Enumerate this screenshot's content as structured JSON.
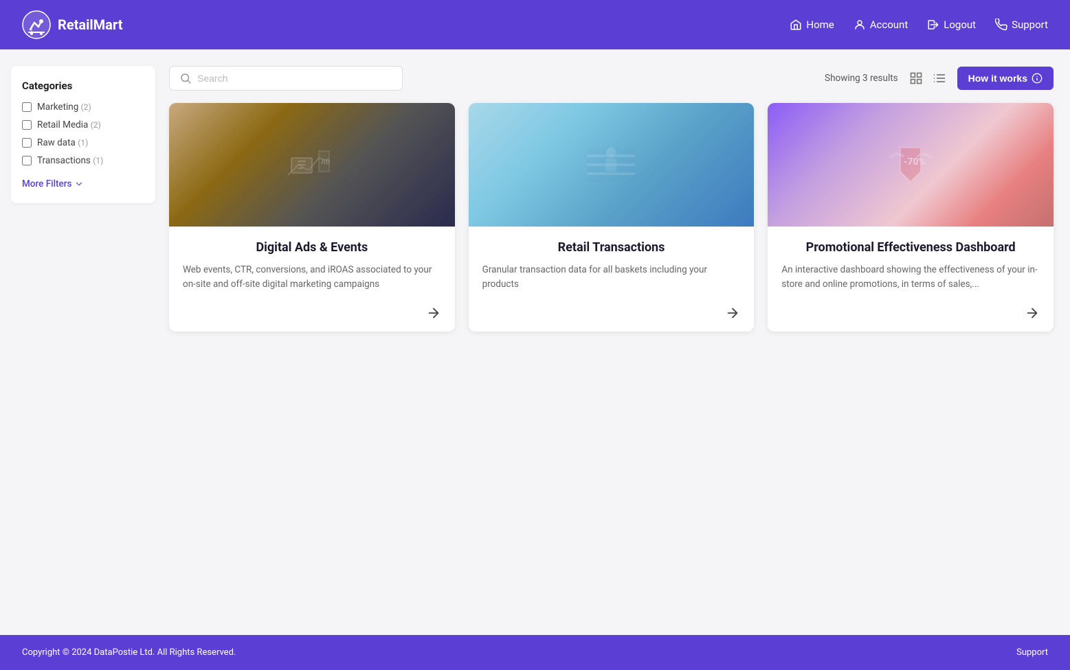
{
  "header": {
    "logo_text": "RetailMart",
    "nav": {
      "home": "Home",
      "account": "Account",
      "logout": "Logout",
      "support": "Support"
    }
  },
  "sidebar": {
    "title": "Categories",
    "filters": [
      {
        "label": "Marketing",
        "count": "(2)",
        "checked": false
      },
      {
        "label": "Retail Media",
        "count": "(2)",
        "checked": false
      },
      {
        "label": "Raw data",
        "count": "(1)",
        "checked": false
      },
      {
        "label": "Transactions",
        "count": "(1)",
        "checked": false
      }
    ],
    "more_filters": "More Filters"
  },
  "toolbar": {
    "search_placeholder": "Search",
    "results_count": "Showing 3 results",
    "how_it_works": "How it works"
  },
  "cards": [
    {
      "title": "Digital Ads & Events",
      "description": "Web events, CTR, conversions, and iROAS associated to your on-site and off-site digital marketing campaigns"
    },
    {
      "title": "Retail Transactions",
      "description": "Granular transaction data for all baskets including your products"
    },
    {
      "title": "Promotional Effectiveness Dashboard",
      "description": "An interactive dashboard showing the effectiveness of your in-store and online promotions, in terms of sales,..."
    }
  ],
  "footer": {
    "copyright": "Copyright © 2024 DataPostie Ltd. All Rights Reserved.",
    "support": "Support"
  }
}
